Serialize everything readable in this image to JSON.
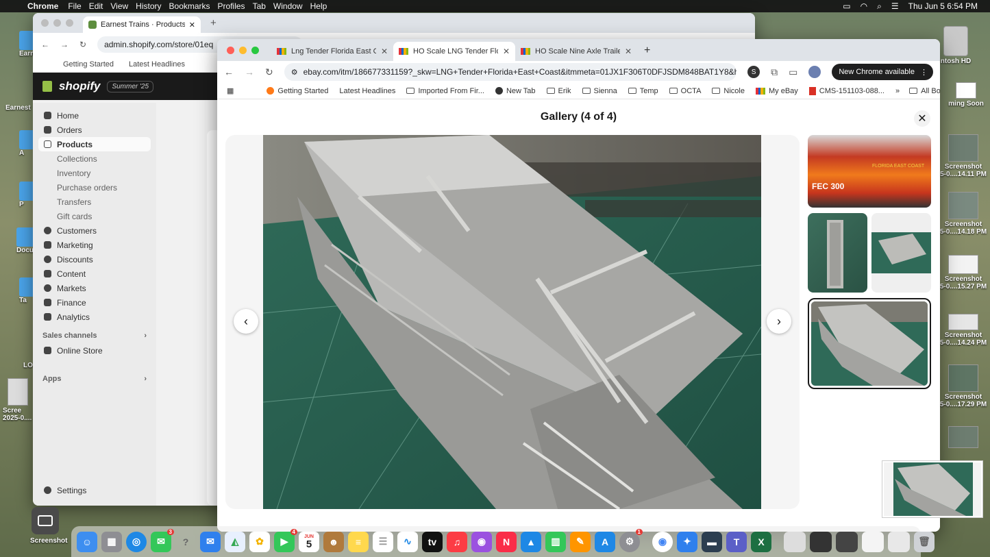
{
  "menubar": {
    "app": "Chrome",
    "items": [
      "File",
      "Edit",
      "View",
      "History",
      "Bookmarks",
      "Profiles",
      "Tab",
      "Window",
      "Help"
    ],
    "clock": "Thu Jun 5  6:54 PM"
  },
  "desktop": {
    "right_items": [
      "ntosh HD",
      "ming Soon",
      "Screenshot\n5-0....14.11 PM",
      "Screenshot\n5-0....14.18 PM",
      "Screenshot\n5-0....15.27 PM",
      "Screenshot\n5-0....14.24 PM",
      "Screenshot\n5-0....17.29 PM"
    ],
    "left_items": [
      "Earn",
      "Earnest",
      "A",
      "P",
      "Docu",
      "Ta",
      "LO",
      "Scree\n2025-0...."
    ],
    "screenshot_tool": "Screenshot"
  },
  "back_window": {
    "tab_title": "Earnest Trains · Products · HO",
    "url": "admin.shopify.com/store/01eq",
    "bookmarks": [
      "Getting Started",
      "Latest Headlines"
    ],
    "brand": "shopify",
    "badge": "Summer '25",
    "nav": [
      {
        "label": "Home",
        "type": "main"
      },
      {
        "label": "Orders",
        "type": "main"
      },
      {
        "label": "Products",
        "type": "active"
      },
      {
        "label": "Collections",
        "type": "sub"
      },
      {
        "label": "Inventory",
        "type": "sub"
      },
      {
        "label": "Purchase orders",
        "type": "sub"
      },
      {
        "label": "Transfers",
        "type": "sub"
      },
      {
        "label": "Gift cards",
        "type": "sub"
      },
      {
        "label": "Customers",
        "type": "main"
      },
      {
        "label": "Marketing",
        "type": "main"
      },
      {
        "label": "Discounts",
        "type": "main"
      },
      {
        "label": "Content",
        "type": "main"
      },
      {
        "label": "Markets",
        "type": "main"
      },
      {
        "label": "Finance",
        "type": "main"
      },
      {
        "label": "Analytics",
        "type": "main"
      }
    ],
    "sales_channels": "Sales channels",
    "online_store": "Online Store",
    "apps": "Apps",
    "settings": "Settings"
  },
  "front_window": {
    "tabs": [
      {
        "title": "Lng Tender Florida East Coas",
        "active": false
      },
      {
        "title": "HO Scale LNG Tender Florida",
        "active": true
      },
      {
        "title": "HO Scale Nine Axle Trailer HE",
        "active": false
      }
    ],
    "url_domain": "ebay.com",
    "url_rest": "/itm/186677331159?_skw=LNG+Tender+Florida+East+Coast&itmmeta=01JX1F306T0DFJSDM848BAT1Y8&hash=i...",
    "chrome_available": "New Chrome available",
    "bookmarks": [
      "Getting Started",
      "Latest Headlines",
      "Imported From Fir...",
      "New Tab",
      "Erik",
      "Sienna",
      "Temp",
      "OCTA",
      "Nicole",
      "My eBay",
      "CMS-151103-088..."
    ],
    "all_bookmarks": "All Bookmarks",
    "overflow": "»"
  },
  "gallery": {
    "title": "Gallery (4 of 4)",
    "close": "✕",
    "prev": "‹",
    "next": "›",
    "thumb1_caption": "FEC 300",
    "thumb1_marking": "FLORIDA EAST COAST"
  },
  "dock": {
    "messages_badge": "3",
    "facetime_badge": "4",
    "settings_badge": "1",
    "calendar_month": "JUN",
    "calendar_day": "5"
  }
}
